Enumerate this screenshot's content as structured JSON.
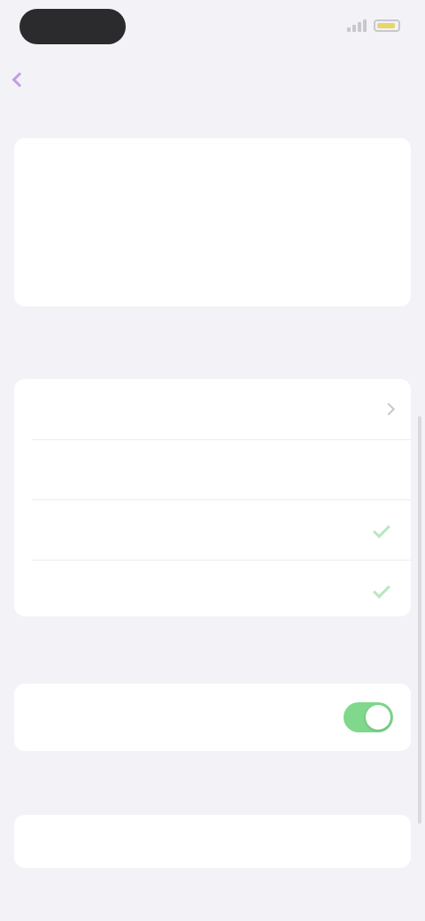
{
  "status_bar": {
    "time": "",
    "battery_color": "#e8d66a"
  },
  "nav": {
    "back_label": "",
    "title": ""
  },
  "sections": {
    "intro_caption": "",
    "intro_lines": [
      "",
      "",
      ""
    ],
    "group1_header": "",
    "group1_rows": [
      {
        "label": "",
        "detail": ""
      },
      {
        "label": "",
        "detail": ""
      },
      {
        "label": "",
        "detail": ""
      },
      {
        "label": "",
        "detail": ""
      }
    ],
    "group2_header": "",
    "group2_row_label": "",
    "group2_toggle_on": true,
    "group3_header": "",
    "group3_row_label": ""
  },
  "colors": {
    "accent": "#c79be8",
    "toggle_on": "#7fd88b",
    "background": "#f2f2f7"
  }
}
